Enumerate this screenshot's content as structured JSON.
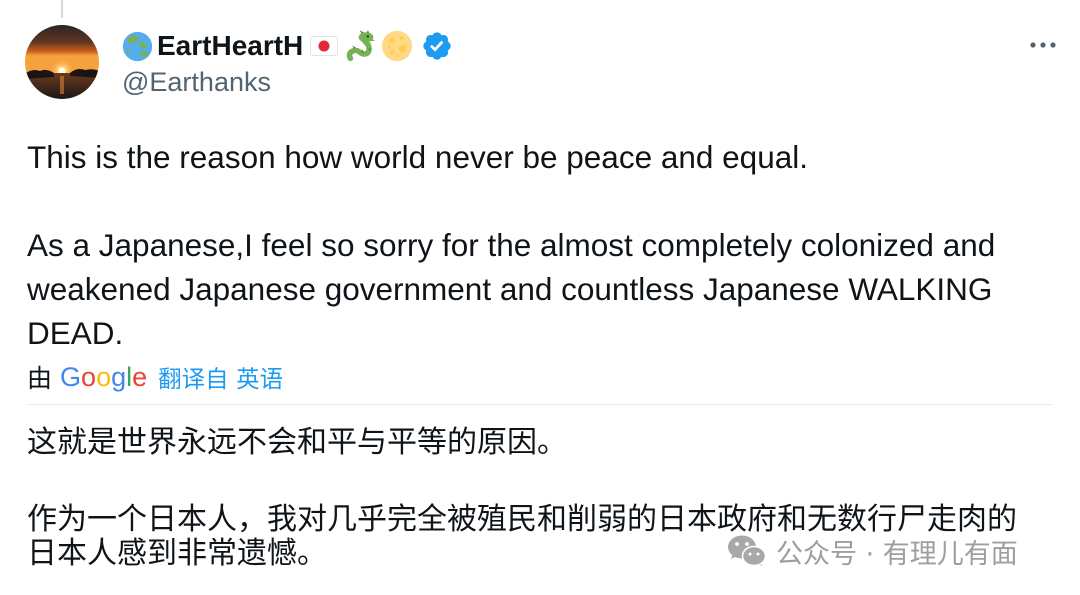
{
  "tweet": {
    "author": {
      "display_name": "EartHeartH",
      "handle": "@Earthanks",
      "verified": true,
      "avatar_icon": "sunset-avatar",
      "name_icons": [
        "globe-asia-australia-emoji",
        "flag-japan-emoji",
        "dragon-emoji",
        "full-moon-emoji",
        "verified-badge-icon"
      ]
    },
    "more_icon": "more-horizontal-icon",
    "original_text": [
      [
        "This is the reason how world never be peace and equal."
      ],
      [
        "As a Japanese,I feel so sorry for the almost completely colonized and",
        "weakened Japanese government and countless Japanese WALKING",
        "DEAD."
      ]
    ],
    "translation_credit": {
      "prefix": "由",
      "provider": "Google",
      "link_text": "翻译自 英语"
    },
    "translated_text": [
      [
        "这就是世界永远不会和平与平等的原因。"
      ],
      [
        "作为一个日本人，我对几乎完全被殖民和削弱的日本政府和无数行尸走肉的",
        "日本人感到非常遗憾。"
      ]
    ]
  },
  "watermark": {
    "icon": "wechat-icon",
    "text": "公众号 · 有理儿有面"
  },
  "colors": {
    "text": "#0f1419",
    "secondary": "#536471",
    "accent": "#1d9bf0",
    "verified": "#1d9bf0",
    "watermark": "#9e9e9e",
    "google_letters": [
      "#4285F4",
      "#EA4335",
      "#FBBC05",
      "#4285F4",
      "#34A853",
      "#EA4335"
    ]
  }
}
